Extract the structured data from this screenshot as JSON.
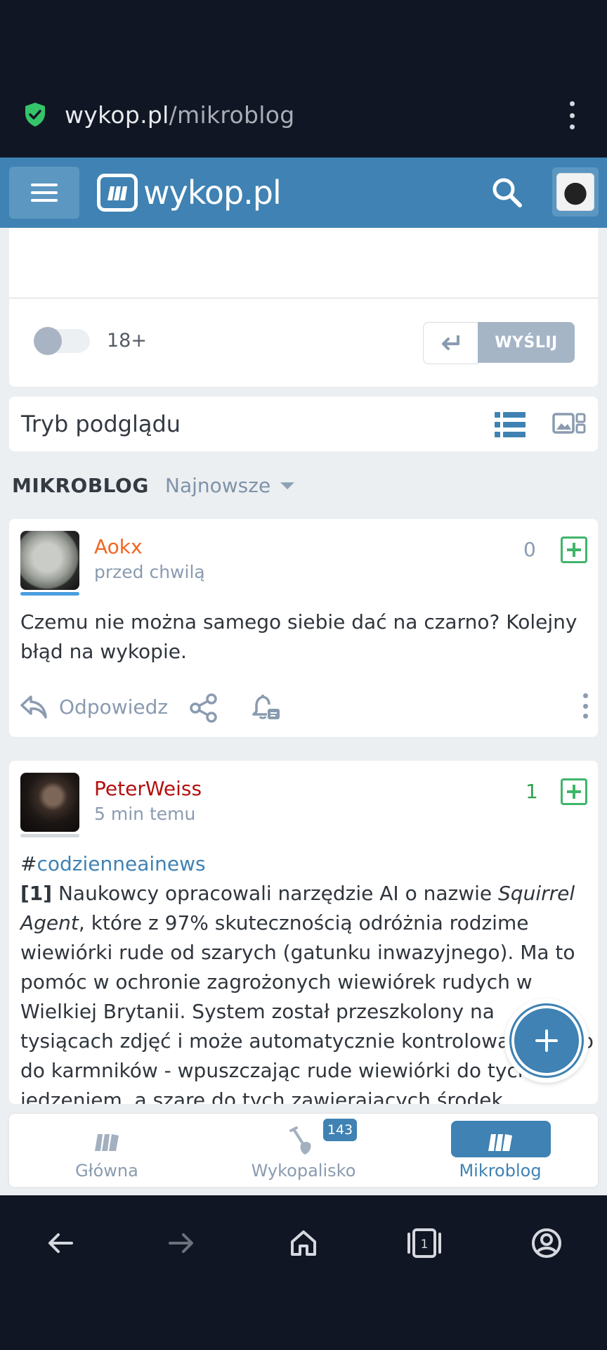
{
  "browser": {
    "url_host": "wykop.pl",
    "url_path": "/mikroblog"
  },
  "site": {
    "logo_text": "wykop.pl"
  },
  "composer": {
    "adult_toggle_label": "18+",
    "send_label": "WYŚLIJ"
  },
  "preview": {
    "title": "Tryb podglądu"
  },
  "section": {
    "title": "MIKROBLOG",
    "sort_value": "Najnowsze"
  },
  "entries": [
    {
      "author": "Aokx",
      "time": "przed chwilą",
      "votes": "0",
      "body": "Czemu nie można samego siebie dać na czarno? Kolejny błąd na wykopie.",
      "reply_label": "Odpowiedz"
    },
    {
      "author": "PeterWeiss",
      "time": "5 min temu",
      "votes": "1",
      "tag": "codzienneainews",
      "index": "[1]",
      "text_a": " Naukowcy opracowali narzędzie AI o nazwie ",
      "italic": "Squirrel Agent",
      "text_b": ", które z 97% skutecznością odróżnia rodzime wiewiórki rude od szarych (gatunku inwazyjnego). Ma to pomóc w ochronie zagrożonych wiewiórek rudych w Wielkiej Brytanii. System został przeszkolony na tysiącach zdjęć i może automatycznie kontrolować dostęp do karmników - wpuszczając rude wiewiórki do tych z jedzeniem, a szare do tych zawierających środek"
    }
  ],
  "bottom_nav": {
    "items": [
      {
        "label": "Główna"
      },
      {
        "label": "Wykopalisko",
        "badge": "143"
      },
      {
        "label": "Mikroblog"
      }
    ]
  },
  "colors": {
    "brand": "#3f82b3",
    "vote_plus": "#3fb56b",
    "author1": "#f26522",
    "author2": "#b3100f"
  }
}
